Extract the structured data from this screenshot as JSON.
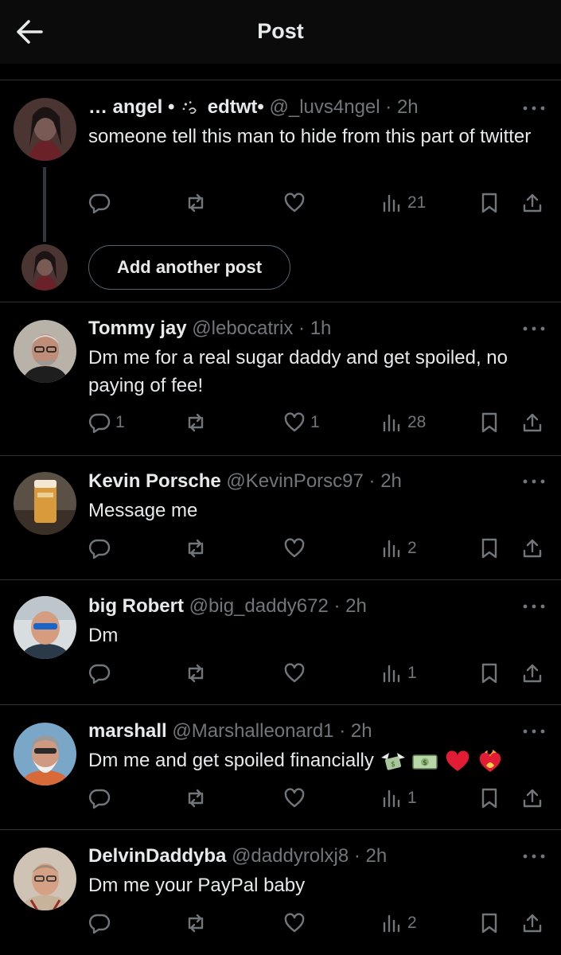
{
  "header": {
    "title": "Post"
  },
  "composer": {
    "add_label": "Add another post"
  },
  "posts": [
    {
      "name": "… angel •",
      "name_suffix": "edtwt•",
      "handle": "@_luvs4ngel",
      "time": "· 2h",
      "text": "someone tell this man to hide from this part of twitter",
      "replies": "",
      "reposts": "",
      "likes": "",
      "views": "21"
    },
    {
      "name": "Tommy jay",
      "handle": "@lebocatrix",
      "time": "· 1h",
      "text": "Dm me for a real sugar daddy and get spoiled, no paying of fee!",
      "replies": "1",
      "reposts": "",
      "likes": "1",
      "views": "28"
    },
    {
      "name": "Kevin Porsche",
      "handle": "@KevinPorsc97",
      "time": "· 2h",
      "text": "Message me",
      "replies": "",
      "reposts": "",
      "likes": "",
      "views": "2"
    },
    {
      "name": "big Robert",
      "handle": "@big_daddy672",
      "time": "· 2h",
      "text": "Dm",
      "replies": "",
      "reposts": "",
      "likes": "",
      "views": "1"
    },
    {
      "name": "marshall",
      "handle": "@Marshalleonard1",
      "time": "· 2h",
      "text": "Dm me and get spoiled financially",
      "replies": "",
      "reposts": "",
      "likes": "",
      "views": "1"
    },
    {
      "name": "DelvinDaddyba",
      "handle": "@daddyrolxj8",
      "time": "· 2h",
      "text": "Dm me your PayPal baby",
      "replies": "",
      "reposts": "",
      "likes": "",
      "views": "2"
    }
  ],
  "icons": {
    "back": "arrow-left-icon",
    "more": "more-dots-icon",
    "reply": "reply-icon",
    "repost": "repost-icon",
    "like": "heart-icon",
    "views": "views-icon",
    "bookmark": "bookmark-icon",
    "share": "share-icon"
  },
  "colors": {
    "background": "#000000",
    "text": "#e7e9ea",
    "secondary": "#71767b",
    "divider": "#2f3336",
    "heart_emoji": "#e0245e"
  }
}
